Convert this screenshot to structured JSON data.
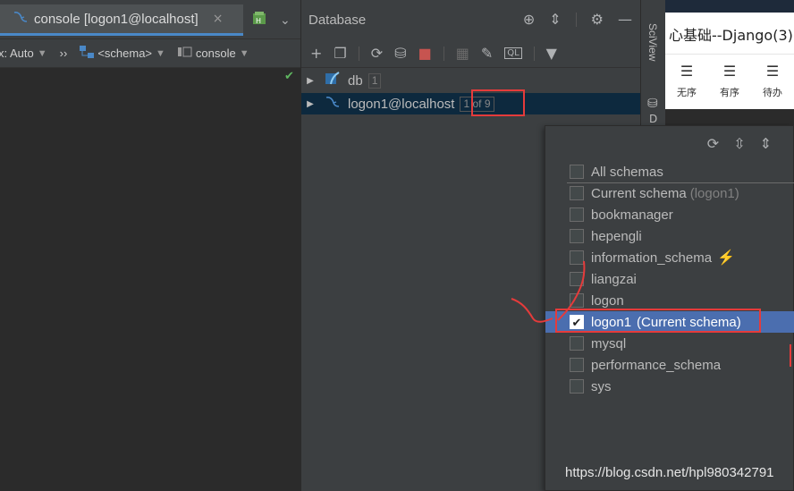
{
  "editor": {
    "tab_title": "console [logon1@localhost]",
    "tab_close": "×",
    "toolbar": {
      "tx_label": "x: Auto",
      "more": "››",
      "schema_label": "<schema>",
      "console_label": "console"
    }
  },
  "database": {
    "title": "Database",
    "tree": [
      {
        "label": "db",
        "count": "1"
      },
      {
        "label": "logon1@localhost",
        "count": "1 of 9"
      }
    ]
  },
  "side_strip": {
    "vertical_label": "SciView",
    "second_label": "D"
  },
  "browser": {
    "title": "心基础--Django(3)",
    "tools": [
      {
        "label": "无序",
        "icon": "☰"
      },
      {
        "label": "有序",
        "icon": "☰"
      },
      {
        "label": "待办",
        "icon": "☰"
      }
    ]
  },
  "schema_popup": {
    "options": [
      {
        "label": "All schemas",
        "checked": false
      },
      {
        "label": "Current schema",
        "note": "(logon1)",
        "checked": false
      },
      {
        "label": "bookmanager",
        "checked": false
      },
      {
        "label": "hepengli",
        "checked": false
      },
      {
        "label": "information_schema",
        "checked": false
      },
      {
        "label": "liangzai",
        "checked": false
      },
      {
        "label": "logon",
        "checked": false
      },
      {
        "label": "logon1",
        "note": "(Current schema)",
        "checked": true
      },
      {
        "label": "mysql",
        "checked": false
      },
      {
        "label": "performance_schema",
        "checked": false
      },
      {
        "label": "sys",
        "checked": false
      }
    ]
  },
  "watermark": "https://blog.csdn.net/hpl980342791",
  "colors": {
    "selection": "#4b6eaf",
    "annotation_red": "#e53b3b",
    "accent_blue": "#4a88c7"
  }
}
